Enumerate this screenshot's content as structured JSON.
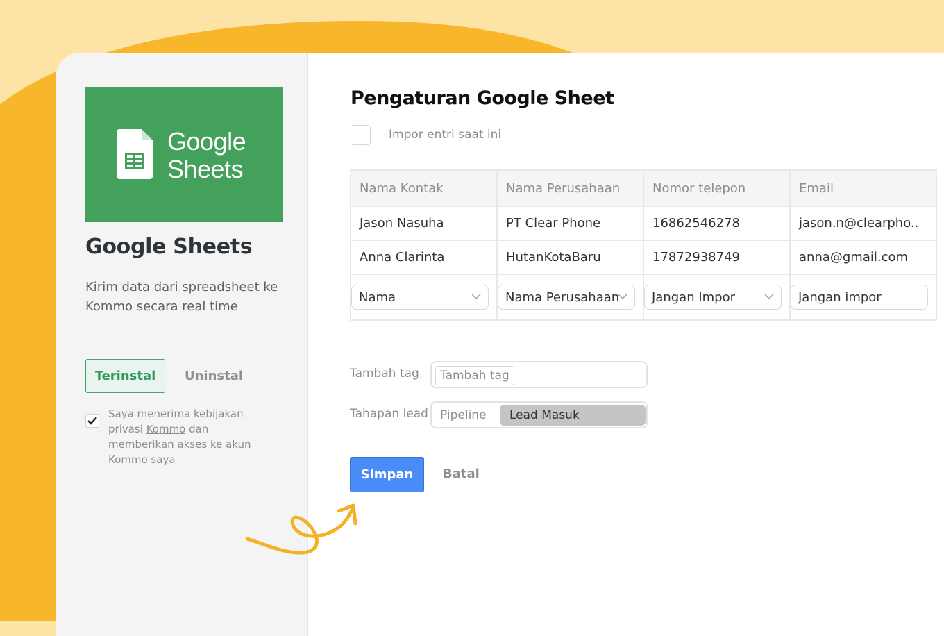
{
  "colors": {
    "accent_orange": "#f8b72b",
    "sheets_green": "#43a15b",
    "save_blue": "#4a8cf7",
    "installed_green": "#2e9a5f"
  },
  "sidebar": {
    "logo_text_line1": "Google",
    "logo_text_line2": "Sheets",
    "logo_icon": "google-sheets-icon",
    "title": "Google Sheets",
    "description": "Kirim data dari spreadsheet ke Kommo secara real time",
    "installed_label": "Terinstal",
    "uninstall_label": "Uninstal",
    "consent": {
      "checked": true,
      "text_before": "Saya menerima kebijakan privasi ",
      "link_text": "Kommo",
      "text_after": " dan memberikan akses ke akun Kommo saya"
    }
  },
  "main": {
    "title": "Pengaturan Google Sheet",
    "import_checkbox_label": "Impor entri saat ini",
    "import_checked": false,
    "table": {
      "headers": [
        "Nama Kontak",
        "Nama Perusahaan",
        "Nomor telepon",
        "Email"
      ],
      "rows": [
        [
          "Jason Nasuha",
          "PT Clear Phone",
          "16862546278",
          "jason.n@clearpho.."
        ],
        [
          "Anna Clarinta",
          "HutanKotaBaru",
          "17872938749",
          "anna@gmail.com"
        ]
      ],
      "mappings": [
        "Nama",
        "Nama Perusahaan",
        "Jangan Impor",
        "Jangan impor"
      ]
    },
    "tag_label": "Tambah tag",
    "tag_chip": "Tambah tag",
    "stage_label": "Tahapan lead",
    "stage_pipeline": "Pipeline",
    "stage_selected": "Lead Masuk",
    "save_label": "Simpan",
    "cancel_label": "Batal"
  }
}
